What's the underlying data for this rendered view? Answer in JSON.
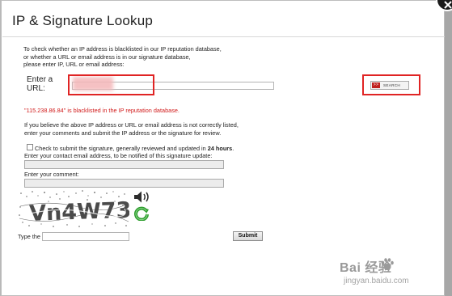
{
  "dialog": {
    "title": "IP & Signature Lookup"
  },
  "intro": {
    "lines": [
      "To check whether an IP address is blacklisted in our IP reputation database,",
      "or whether a URL or email address is in our signature database,",
      "please enter IP, URL or email address:"
    ]
  },
  "lookup": {
    "label_line1": "Enter a",
    "label_line2": "URL:",
    "input_value": "",
    "search_arrow": ">>",
    "search_label": "SEARCH"
  },
  "result": {
    "text": "\"115.238.86.84\" is blacklisted in the IP reputation database."
  },
  "believe": {
    "lines": [
      "If you believe the above IP address or URL or email address is not correctly listed,",
      "enter your comments and submit the IP address or the signature for review."
    ]
  },
  "review": {
    "check_label_prefix": "Check to submit the signature, generally reviewed and updated in ",
    "check_label_bold": "24 hours",
    "check_label_suffix": ".",
    "checked": false,
    "email_label": "Enter your contact email address, to be notified of this signature update:",
    "comment_label": "Enter your comment:"
  },
  "captcha": {
    "text": "Vn4W73",
    "type_label": "Type the text:",
    "submit_label": "Submit"
  },
  "watermark": {
    "main": "Bai  经验",
    "sub": "jingyan.baidu.com"
  },
  "colors": {
    "highlight_red": "#e02424",
    "result_red": "#d11a1a",
    "search_arrow_bg": "#c0211f"
  },
  "icons": [
    "close-icon",
    "speaker-icon",
    "refresh-icon",
    "paw-icon"
  ]
}
